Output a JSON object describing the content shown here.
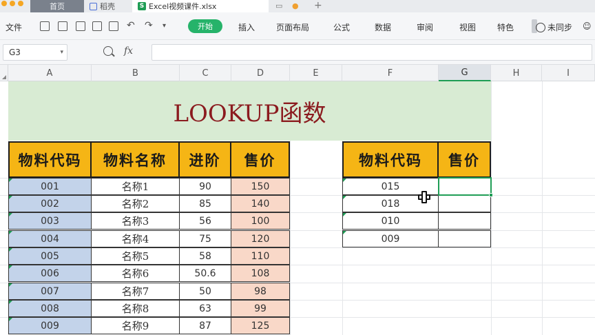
{
  "tabs": {
    "home": "首页",
    "daoke": "稻壳",
    "file": "Excel视频课件.xlsx",
    "add": "+"
  },
  "menu": {
    "file": "文件",
    "start": "开始",
    "insert": "插入",
    "page_layout": "页面布局",
    "formula": "公式",
    "data": "数据",
    "review": "审阅",
    "view": "视图",
    "special": "特色",
    "sync": "未同步"
  },
  "formula_bar": {
    "cell_ref": "G3",
    "fx_label": "fx",
    "formula": ""
  },
  "columns": [
    "A",
    "B",
    "C",
    "D",
    "E",
    "F",
    "G",
    "H",
    "I"
  ],
  "active_column": "G",
  "sheet": {
    "title": "LOOKUP函数",
    "left_table": {
      "headers": [
        "物料代码",
        "物料名称",
        "进阶",
        "售价"
      ],
      "rows": [
        [
          "001",
          "名称1",
          "90",
          "150"
        ],
        [
          "002",
          "名称2",
          "85",
          "140"
        ],
        [
          "003",
          "名称3",
          "56",
          "100"
        ],
        [
          "004",
          "名称4",
          "75",
          "120"
        ],
        [
          "005",
          "名称5",
          "58",
          "110"
        ],
        [
          "006",
          "名称6",
          "50.6",
          "108"
        ],
        [
          "007",
          "名称7",
          "50",
          "98"
        ],
        [
          "008",
          "名称8",
          "63",
          "99"
        ],
        [
          "009",
          "名称9",
          "87",
          "125"
        ]
      ]
    },
    "right_table": {
      "headers": [
        "物料代码",
        "售价"
      ],
      "rows": [
        [
          "015",
          ""
        ],
        [
          "018",
          ""
        ],
        [
          "010",
          ""
        ],
        [
          "009",
          ""
        ]
      ]
    }
  },
  "colors": {
    "accent_green": "#1f9d55",
    "header_yellow": "#f5b515",
    "code_blue": "#c3d3ea",
    "price_peach": "#f9d8c8",
    "title_band": "#d8ebd3",
    "title_text": "#8b1b1f"
  }
}
